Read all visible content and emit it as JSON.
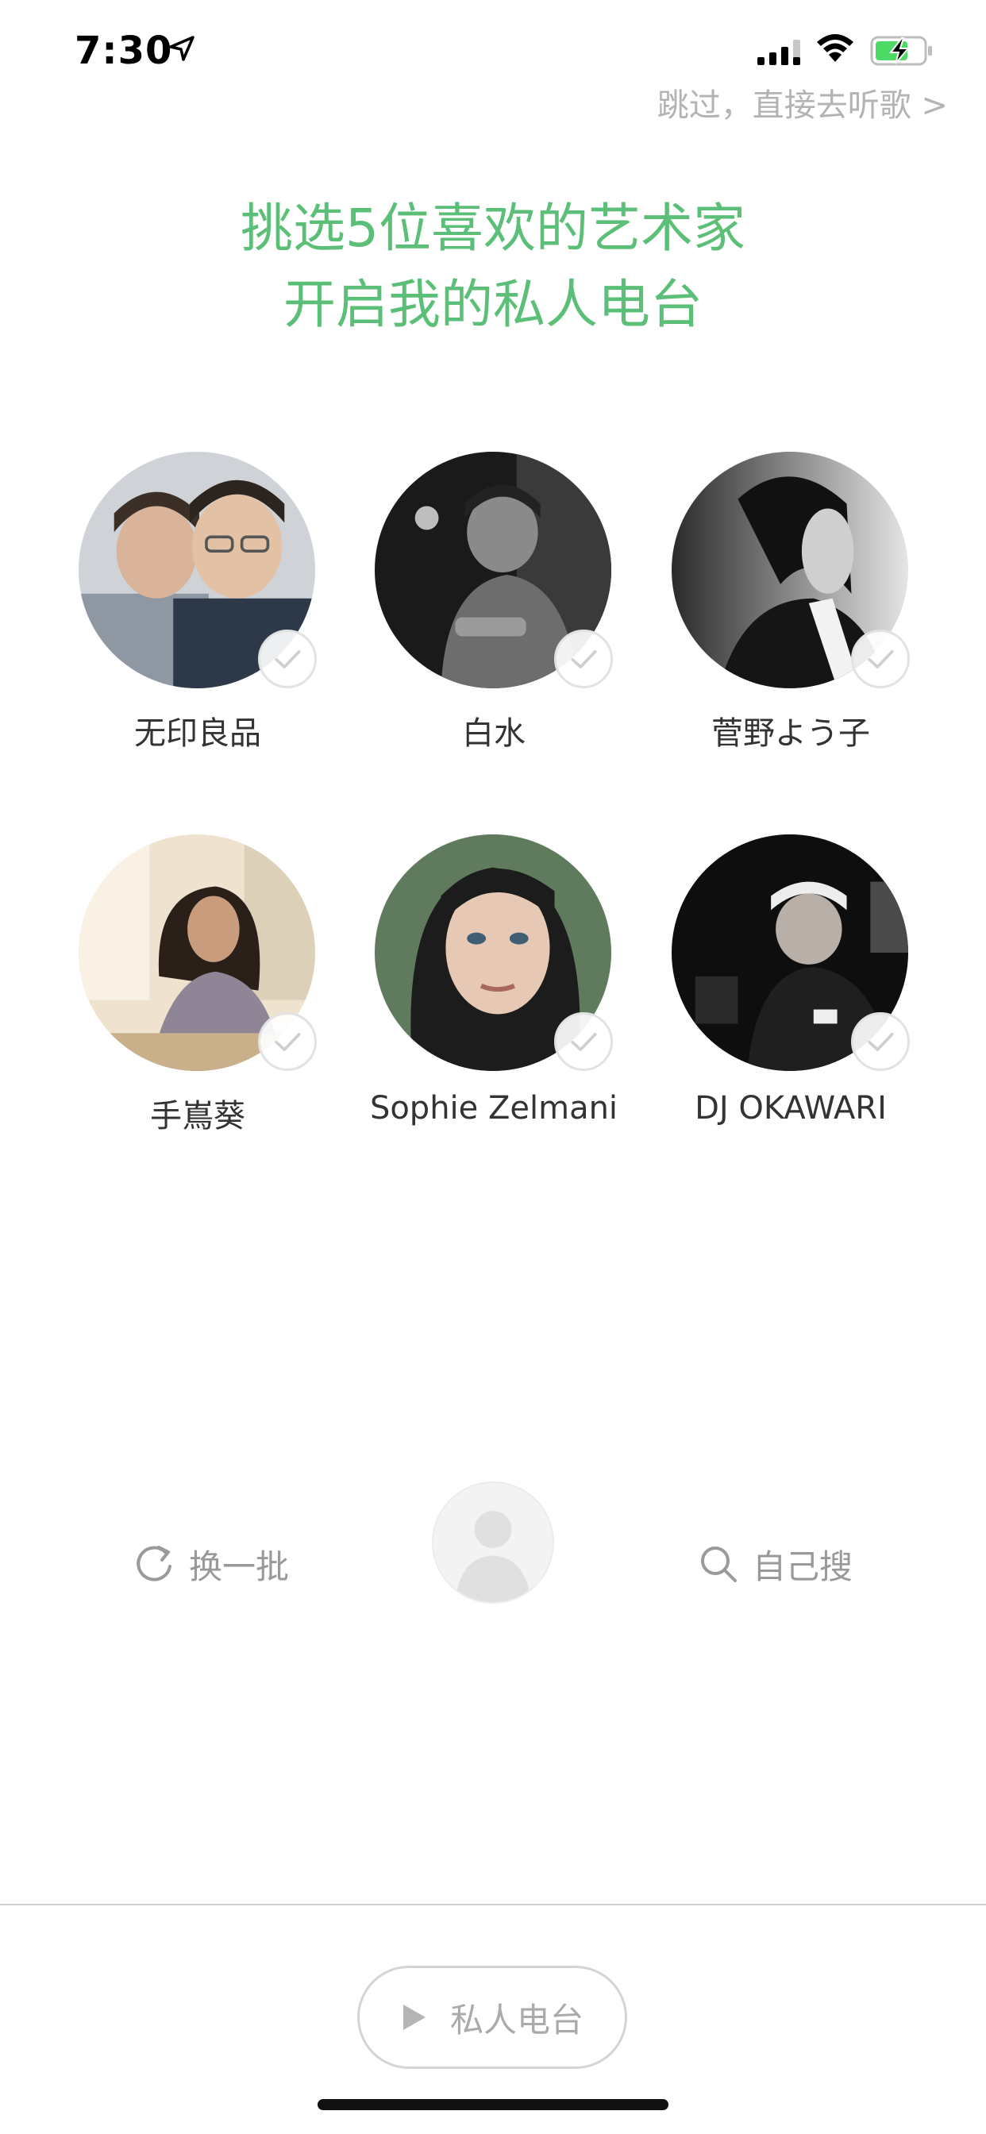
{
  "status_bar": {
    "time": "7:30",
    "icons": [
      "location-arrow-icon",
      "cellular-signal-icon",
      "wifi-icon",
      "battery-charging-icon"
    ],
    "battery_color": "#4cd964"
  },
  "skip_label": "跳过，直接去听歌 >",
  "headline": {
    "line1": "挑选5位喜欢的艺术家",
    "line2": "开启我的私人电台",
    "color": "#5cbf78"
  },
  "artists": [
    {
      "name": "无印良品"
    },
    {
      "name": "白水"
    },
    {
      "name": "菅野よう子"
    },
    {
      "name": "手嶌葵"
    },
    {
      "name": "Sophie Zelmani"
    },
    {
      "name": "DJ OKAWARI"
    }
  ],
  "actions": {
    "refresh_label": "换一批",
    "search_label": "自己搜"
  },
  "radio_button_label": "私人电台"
}
